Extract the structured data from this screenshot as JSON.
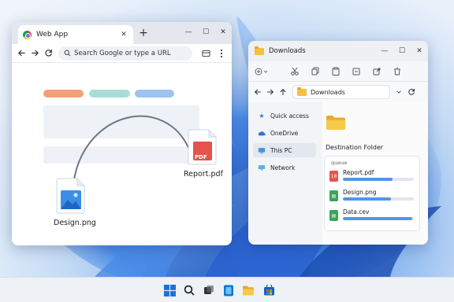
{
  "browser": {
    "tab_title": "Web App",
    "tab_close": "✕",
    "new_tab": "+",
    "window_controls": [
      "—",
      "☐",
      "✕"
    ],
    "omnibox_placeholder": "Search Google or type a URL",
    "toolbar_icons": [
      "tab-search-icon",
      "more-vert-icon"
    ]
  },
  "drag": {
    "source_file": {
      "name": "Design.png",
      "icon": "image-file-icon"
    },
    "target_file": {
      "name": "Report.pdf",
      "icon": "pdf-file-icon",
      "badge": "PDF"
    }
  },
  "explorer": {
    "title": "Downloads",
    "window_controls": [
      "—",
      "☐",
      "✕"
    ],
    "command_icons": [
      "new-icon",
      "cut-icon",
      "copy-icon",
      "paste-icon",
      "rename-icon",
      "share-icon",
      "delete-icon"
    ],
    "address": "Downloads",
    "sidebar": [
      {
        "label": "Quick access",
        "icon": "star-icon",
        "active": false
      },
      {
        "label": "OneDrive",
        "icon": "cloud-icon",
        "active": false
      },
      {
        "label": "This PC",
        "icon": "monitor-icon",
        "active": true
      },
      {
        "label": "Network",
        "icon": "network-icon",
        "active": false
      }
    ],
    "destination_label": "Destination Folder",
    "queue": {
      "title": "queue",
      "items": [
        {
          "name": "Report.pdf",
          "icon_text": "18",
          "color": "#e5534b",
          "progress": 0.7
        },
        {
          "name": "Design.png",
          "icon_text": "▤",
          "color": "#3fa35a",
          "progress": 0.68
        },
        {
          "name": "Data.cev",
          "icon_text": "▤",
          "color": "#3fa35a",
          "progress": 0.98
        }
      ]
    }
  },
  "taskbar": {
    "icons": [
      "windows-start-icon",
      "search-icon",
      "task-view-icon",
      "app-icon",
      "file-explorer-icon",
      "store-icon"
    ]
  }
}
